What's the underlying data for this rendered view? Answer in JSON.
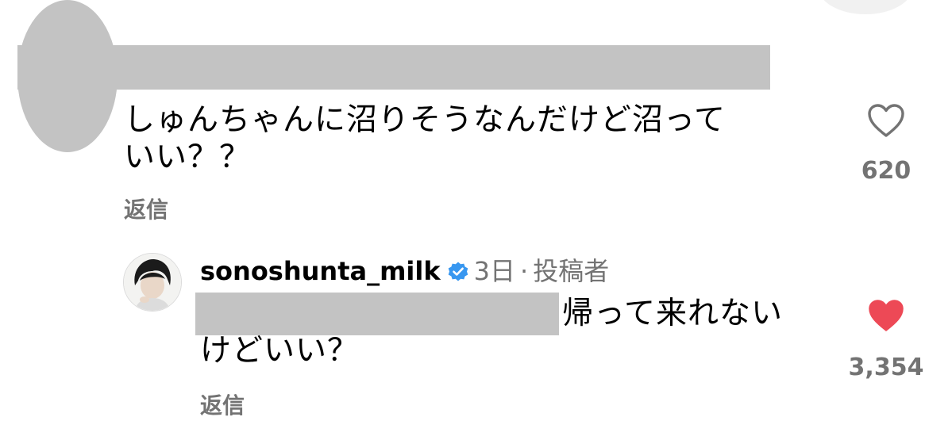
{
  "comment": {
    "text": "しゅんちゃんに沼りそうなんだけど沼っていい？？",
    "reply_label": "返信",
    "like_count": "620",
    "liked": false
  },
  "reply": {
    "username": "sonoshunta_milk",
    "verified": true,
    "time": "3日",
    "separator": "·",
    "author_badge": "投稿者",
    "text": "帰って来れないけどいい？",
    "reply_label": "返信",
    "like_count": "3,354",
    "liked": true
  },
  "colors": {
    "liked_heart": "#ed4956",
    "muted_text": "#737373",
    "verified_blue": "#3897f0",
    "redaction_gray": "#c3c3c3"
  },
  "icons": {
    "comment_like": "heart-outline-icon",
    "reply_like": "heart-filled-icon",
    "verified": "verified-badge-icon"
  }
}
